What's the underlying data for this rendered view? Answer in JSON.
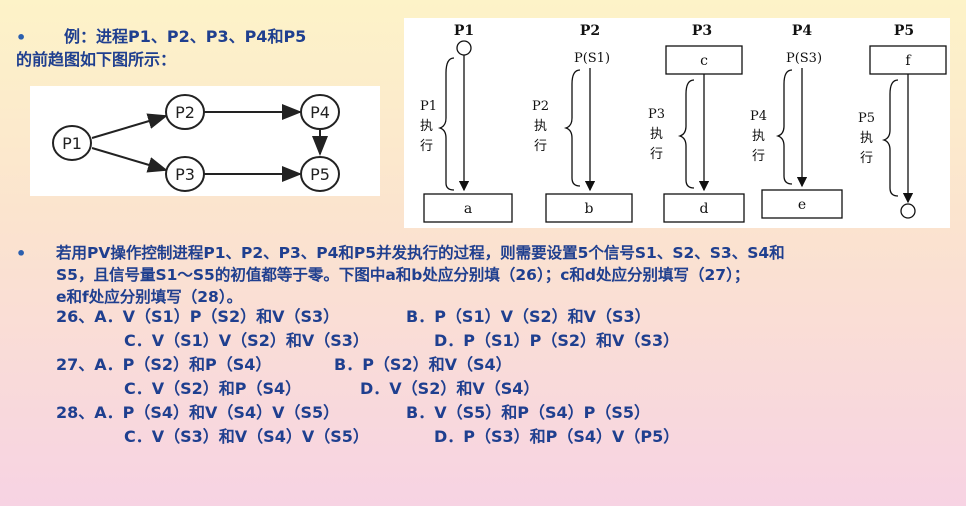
{
  "intro": {
    "bullet": "•",
    "line1": "例：进程P1、P2、P3、P4和P5",
    "line2": "的前趋图如下图所示："
  },
  "precedence_graph": {
    "nodes": [
      "P1",
      "P2",
      "P3",
      "P4",
      "P5"
    ]
  },
  "pv_diagram": {
    "processes": [
      {
        "name": "P1",
        "top": "",
        "label1": "P1",
        "label2": "执",
        "label3": "行",
        "bottom": "a"
      },
      {
        "name": "P2",
        "top": "P(S1)",
        "label1": "P2",
        "label2": "执",
        "label3": "行",
        "bottom": "b"
      },
      {
        "name": "P3",
        "top": "c",
        "label1": "P3",
        "label2": "执",
        "label3": "行",
        "bottom": "d"
      },
      {
        "name": "P4",
        "top": "P(S3)",
        "label1": "P4",
        "label2": "执",
        "label3": "行",
        "bottom": "e"
      },
      {
        "name": "P5",
        "top": "f",
        "label1": "P5",
        "label2": "执",
        "label3": "行",
        "bottom": ""
      }
    ]
  },
  "question": {
    "bullet": "•",
    "line1": "若用PV操作控制进程P1、P2、P3、P4和P5并发执行的过程，则需要设置5个信号S1、S2、S3、S4和",
    "line2": "S5，且信号量S1～S5的初值都等于零。下图中a和b处应分别填（26）；c和d处应分别填写（27）；",
    "line3": "e和f处应分别填写（28）。"
  },
  "options": {
    "q26a": "26、A．V（S1）P（S2）和V（S3）",
    "q26b": "B．P（S1）V（S2）和V（S3）",
    "q26c": "C．V（S1）V（S2）和V（S3）",
    "q26d": "D．P（S1）P（S2）和V（S3）",
    "q27a": "27、A．P（S2）和P（S4）",
    "q27b": "B．P（S2）和V（S4）",
    "q27c": "C．V（S2）和P（S4）",
    "q27d": "D．V（S2）和V（S4）",
    "q28a": "28、A．P（S4）和V（S4）V（S5）",
    "q28b": "B．V（S5）和P（S4）P（S5）",
    "q28c": "C．V（S3）和V（S4）V（S5）",
    "q28d": "D．P（S3）和P（S4）V（P5）"
  }
}
